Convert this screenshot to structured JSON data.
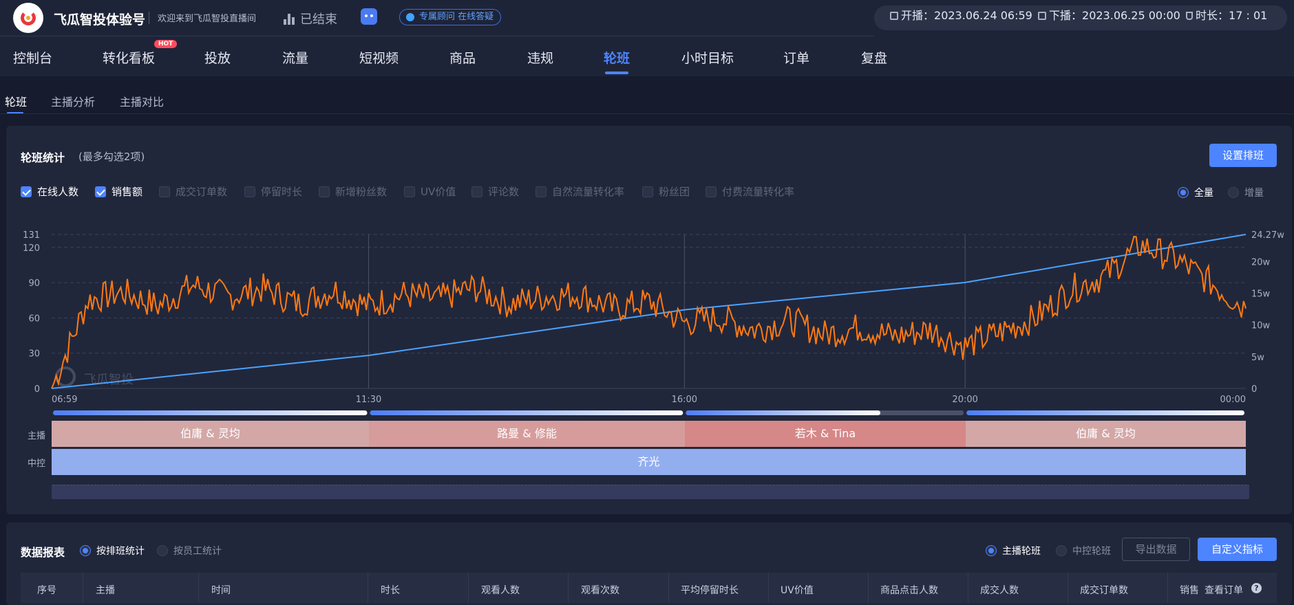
{
  "header": {
    "brand": "飞瓜智投体验号",
    "welcome": "欢迎来到飞瓜智投直播间",
    "status": "已结束",
    "consult": "专属顾问 在线答疑",
    "start_label": "开播：",
    "start_value": "2023.06.24 06:59",
    "end_label": "下播：",
    "end_value": "2023.06.25 00:00",
    "duration_label": "时长：",
    "duration_value": "17 : 01"
  },
  "nav": {
    "items": [
      "控制台",
      "转化看板",
      "投放",
      "流量",
      "短视频",
      "商品",
      "违规",
      "轮班",
      "小时目标",
      "订单",
      "复盘"
    ],
    "hot_badge": "HOT"
  },
  "subtabs": [
    "轮班",
    "主播分析",
    "主播对比"
  ],
  "panel": {
    "title": "轮班统计",
    "subtitle": "(最多勾选2项)",
    "setup_button": "设置排班",
    "checkboxes": [
      {
        "label": "在线人数",
        "checked": true
      },
      {
        "label": "销售额",
        "checked": true
      },
      {
        "label": "成交订单数",
        "checked": false
      },
      {
        "label": "停留时长",
        "checked": false
      },
      {
        "label": "新增粉丝数",
        "checked": false
      },
      {
        "label": "UV价值",
        "checked": false
      },
      {
        "label": "评论数",
        "checked": false
      },
      {
        "label": "自然流量转化率",
        "checked": false
      },
      {
        "label": "粉丝团",
        "checked": false
      },
      {
        "label": "付费流量转化率",
        "checked": false
      }
    ],
    "mode_full": "全量",
    "mode_inc": "增量",
    "watermark": "飞瓜智投"
  },
  "chart_data": {
    "type": "line",
    "x_ticks": [
      "06:59",
      "11:30",
      "16:00",
      "20:00",
      "00:00"
    ],
    "y_left_ticks": [
      "0",
      "30",
      "60",
      "90",
      "120",
      "131"
    ],
    "y_right_ticks": [
      "0",
      "5w",
      "10w",
      "15w",
      "20w",
      "24.27w"
    ],
    "ylim_left": [
      0,
      131
    ],
    "ylim_right": [
      0,
      24.27
    ],
    "grid": true,
    "series": [
      {
        "name": "在线人数",
        "axis": "left",
        "color": "#ff7a14",
        "x": [
          "06:59",
          "07:30",
          "08:00",
          "08:30",
          "09:00",
          "09:30",
          "10:00",
          "10:30",
          "11:00",
          "11:30",
          "12:00",
          "12:30",
          "13:00",
          "13:30",
          "14:00",
          "14:30",
          "15:00",
          "15:30",
          "16:00",
          "16:30",
          "17:00",
          "17:30",
          "18:00",
          "18:30",
          "19:00",
          "19:30",
          "20:00",
          "20:30",
          "21:00",
          "21:30",
          "22:00",
          "22:30",
          "23:00",
          "23:30",
          "00:00"
        ],
        "values": [
          0,
          75,
          82,
          70,
          88,
          78,
          85,
          72,
          84,
          70,
          80,
          76,
          86,
          72,
          78,
          80,
          68,
          74,
          56,
          60,
          50,
          58,
          46,
          52,
          44,
          50,
          36,
          48,
          60,
          84,
          96,
          122,
          110,
          90,
          68
        ]
      },
      {
        "name": "销售额",
        "axis": "right",
        "color": "#4aa3ff",
        "x": [
          "06:59",
          "11:30",
          "16:00",
          "20:00",
          "00:00"
        ],
        "values": [
          0,
          5.2,
          12.4,
          16.7,
          24.27
        ]
      }
    ]
  },
  "schedule": {
    "host_label": "主播",
    "control_label": "中控",
    "hosts": [
      {
        "name": "伯庸 & 灵均",
        "color": "#d4a7a7"
      },
      {
        "name": "路曼 & 修能",
        "color": "#d69c9c"
      },
      {
        "name": "若木 & Tina",
        "color": "#d68787"
      },
      {
        "name": "伯庸 & 灵均",
        "color": "#d4a7a7"
      }
    ],
    "control": "齐光"
  },
  "report": {
    "title": "数据报表",
    "by_shift": "按排班统计",
    "by_staff": "按员工统计",
    "host_shift": "主播轮班",
    "control_shift": "中控轮班",
    "export": "导出数据",
    "custom": "自定义指标",
    "columns": [
      "序号",
      "主播",
      "时间",
      "时长",
      "观看人数",
      "观看次数",
      "平均停留时长",
      "UV价值",
      "商品点击人数",
      "成交人数",
      "成交订单数",
      "销售",
      "查看订单"
    ]
  }
}
